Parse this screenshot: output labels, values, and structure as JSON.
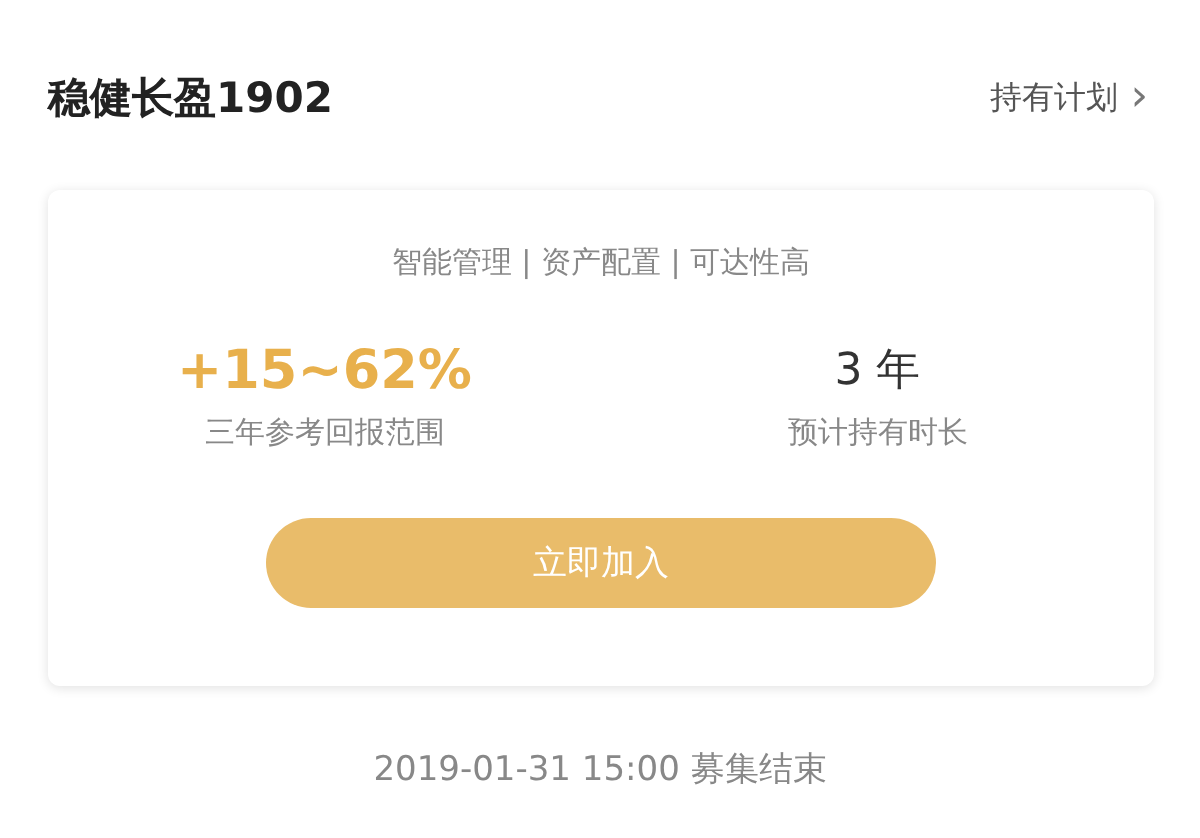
{
  "header": {
    "title": "稳健长盈1902",
    "link": "持有计划",
    "link_arrow": "›"
  },
  "card": {
    "tagline": "智能管理 | 资产配置 | 可达性高",
    "stats": [
      {
        "kind": "highlight",
        "value": "+15~62%",
        "label": "三年参考回报范围"
      },
      {
        "kind": "plain",
        "value": "3 年",
        "label": "预计持有时长"
      }
    ],
    "button": "立即加入"
  },
  "footer": "2019-01-31 15:00 募集结束"
}
